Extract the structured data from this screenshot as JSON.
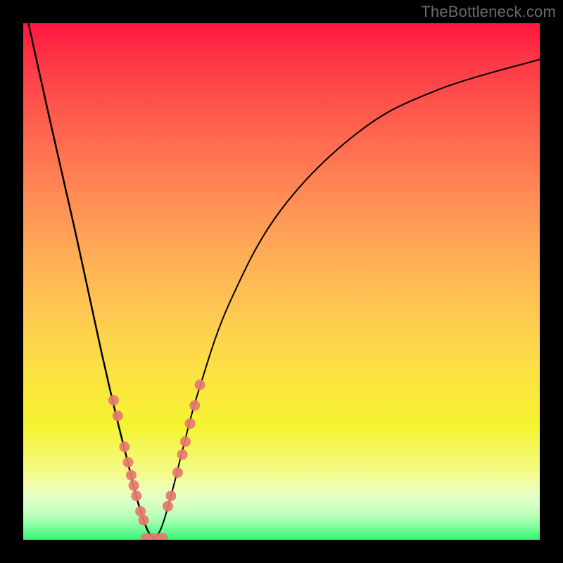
{
  "watermark": "TheBottleneck.com",
  "colors": {
    "marker": "#e7786e",
    "curve": "#000000",
    "background_frame": "#000000"
  },
  "chart_data": {
    "type": "line",
    "title": "",
    "xlabel": "",
    "ylabel": "",
    "xlim": [
      0,
      100
    ],
    "ylim": [
      0,
      100
    ],
    "notes": "Bottleneck-style V-curve on rainbow gradient. No axis ticks or numeric labels are rendered; values are normalized 0–100 on both axes. Left branch descends from top-left to trough near x≈25; right branch rises toward upper-right.",
    "series": [
      {
        "name": "left_branch",
        "x": [
          1,
          5,
          10,
          15,
          18,
          20,
          22,
          24,
          25.5
        ],
        "y": [
          100,
          82,
          60,
          37,
          24,
          16,
          8,
          2,
          0
        ]
      },
      {
        "name": "right_branch",
        "x": [
          25.5,
          27,
          29,
          31,
          34,
          40,
          50,
          65,
          80,
          100
        ],
        "y": [
          0,
          3,
          10,
          18,
          29,
          46,
          64,
          79,
          87,
          93
        ]
      }
    ],
    "markers": {
      "note": "Salmon-colored dots clustered along lower portions of both branches near the trough, plus a rounded cap segment at the very bottom.",
      "points": [
        {
          "branch": "left",
          "x": 17.5,
          "y": 27
        },
        {
          "branch": "left",
          "x": 18.3,
          "y": 24
        },
        {
          "branch": "left",
          "x": 19.6,
          "y": 18
        },
        {
          "branch": "left",
          "x": 20.3,
          "y": 15
        },
        {
          "branch": "left",
          "x": 20.9,
          "y": 12.5
        },
        {
          "branch": "left",
          "x": 21.4,
          "y": 10.5
        },
        {
          "branch": "left",
          "x": 21.9,
          "y": 8.5
        },
        {
          "branch": "left",
          "x": 22.7,
          "y": 5.5
        },
        {
          "branch": "left",
          "x": 23.3,
          "y": 3.8
        },
        {
          "branch": "right",
          "x": 28.0,
          "y": 6.5
        },
        {
          "branch": "right",
          "x": 28.6,
          "y": 8.5
        },
        {
          "branch": "right",
          "x": 29.9,
          "y": 13
        },
        {
          "branch": "right",
          "x": 30.8,
          "y": 16.5
        },
        {
          "branch": "right",
          "x": 31.4,
          "y": 19
        },
        {
          "branch": "right",
          "x": 32.3,
          "y": 22.5
        },
        {
          "branch": "right",
          "x": 33.2,
          "y": 26
        },
        {
          "branch": "right",
          "x": 34.2,
          "y": 30
        }
      ],
      "trough_cap": {
        "x_start": 23.6,
        "x_end": 27.1,
        "y": 0.4
      }
    }
  }
}
